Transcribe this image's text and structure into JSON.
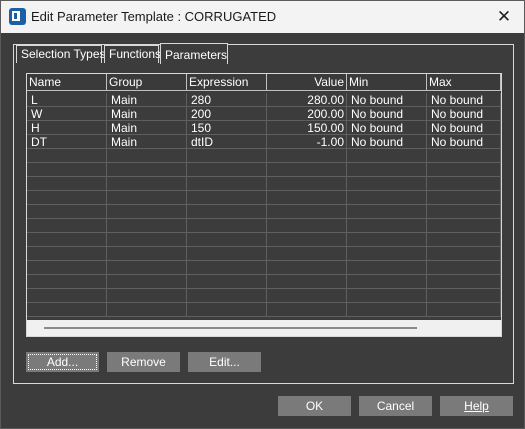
{
  "window": {
    "title": "Edit Parameter Template : CORRUGATED",
    "close_glyph": "✕"
  },
  "tabs": [
    {
      "label": "Selection Types"
    },
    {
      "label": "Functions"
    },
    {
      "label": "Parameters"
    }
  ],
  "table": {
    "columns": [
      "Name",
      "Group",
      "Expression",
      "Value",
      "Min",
      "Max"
    ],
    "rows": [
      {
        "name": "L",
        "group": "Main",
        "expression": "280",
        "value": "280.00",
        "min": "No bound",
        "max": "No bound"
      },
      {
        "name": "W",
        "group": "Main",
        "expression": "200",
        "value": "200.00",
        "min": "No bound",
        "max": "No bound"
      },
      {
        "name": "H",
        "group": "Main",
        "expression": "150",
        "value": "150.00",
        "min": "No bound",
        "max": "No bound"
      },
      {
        "name": "DT",
        "group": "Main",
        "expression": "dtID",
        "value": "-1.00",
        "min": "No bound",
        "max": "No bound"
      }
    ]
  },
  "actions": {
    "add": "Add...",
    "remove": "Remove",
    "edit": "Edit..."
  },
  "footer": {
    "ok": "OK",
    "cancel": "Cancel",
    "help": "Help"
  }
}
